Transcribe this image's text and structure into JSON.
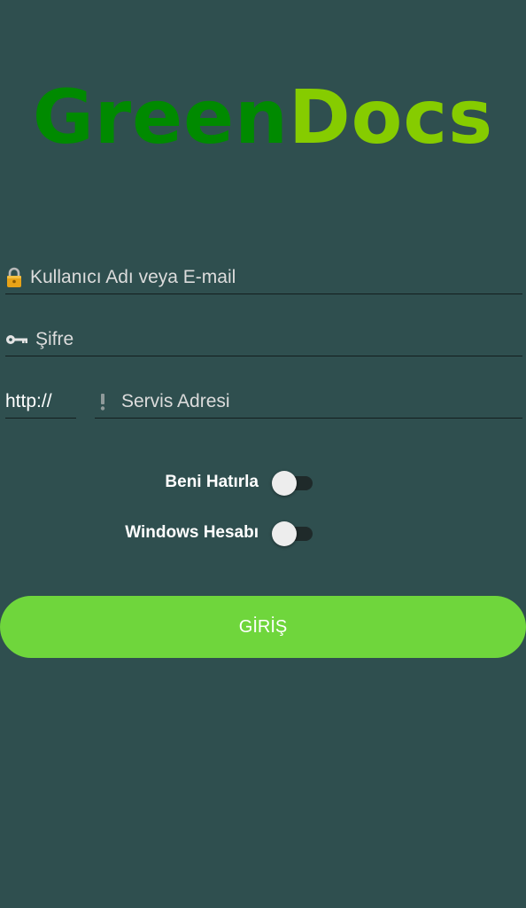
{
  "logo": {
    "part1": "Green",
    "part2": "Docs",
    "color1": "#008a00",
    "color2": "#86cc00"
  },
  "form": {
    "username_placeholder": "Kullanıcı Adı veya E-mail",
    "password_placeholder": "Şifre",
    "protocol_value": "http://",
    "service_placeholder": "Servis Adresi",
    "icons": {
      "username": "lock-icon",
      "password": "key-icon",
      "service": "exclamation-icon"
    }
  },
  "toggles": {
    "remember_label": "Beni Hatırla",
    "remember_on": false,
    "windows_label": "Windows Hesabı",
    "windows_on": false
  },
  "login_button": {
    "label": "GİRİŞ",
    "color": "#6fd63c"
  },
  "theme": {
    "background": "#2f4f4f"
  }
}
